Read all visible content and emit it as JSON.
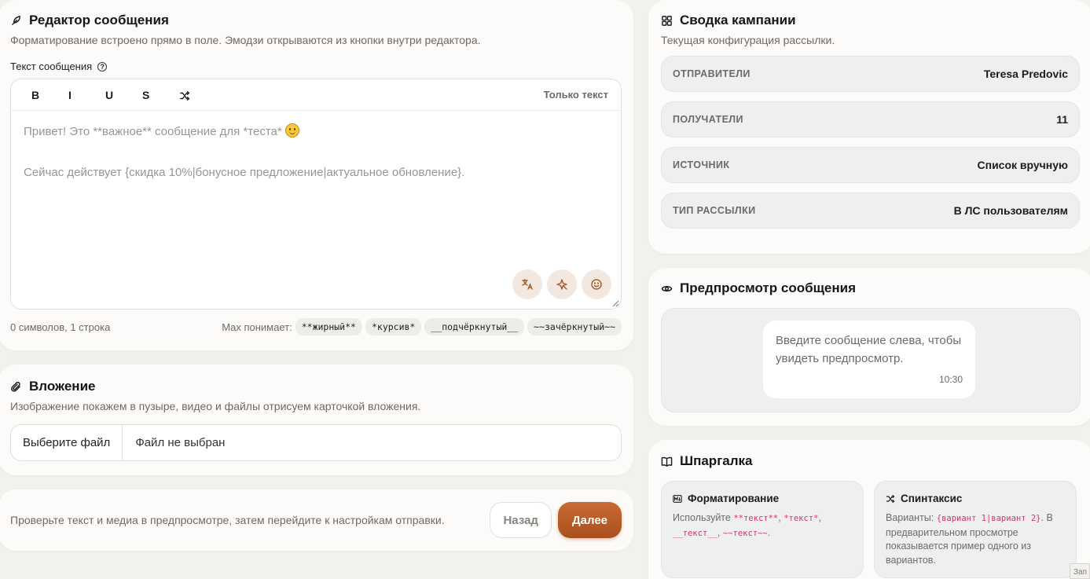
{
  "editor": {
    "title": "Редактор сообщения",
    "subtitle": "Форматирование встроено прямо в поле. Эмодзи открываются из кнопки внутри редактора.",
    "field_label": "Текст сообщения",
    "toolbar": {
      "bold": "B",
      "italic": "I",
      "underline": "U",
      "strike": "S",
      "plain_toggle": "Только текст"
    },
    "placeholder_line1": "Привет! Это **важное** сообщение для *теста*",
    "placeholder_line2": "Сейчас действует {скидка 10%|бонусное предложение|актуальное обновление}.",
    "counter": "0 символов, 1 строка",
    "max_label": "Max понимает:",
    "chips": [
      "**жирный**",
      "*курсив*",
      "__подчёркнутый__",
      "~~зачёркнутый~~"
    ]
  },
  "attachment": {
    "title": "Вложение",
    "subtitle": "Изображение покажем в пузыре, видео и файлы отрисуем карточкой вложения.",
    "choose_button": "Выберите файл",
    "file_status": "Файл не выбран"
  },
  "navigation": {
    "hint": "Проверьте текст и медиа в предпросмотре, затем перейдите к настройкам отправки.",
    "back": "Назад",
    "next": "Далее"
  },
  "summary": {
    "title": "Сводка кампании",
    "subtitle": "Текущая конфигурация рассылки.",
    "rows": [
      {
        "key": "ОТПРАВИТЕЛИ",
        "value": "Teresa Predovic"
      },
      {
        "key": "ПОЛУЧАТЕЛИ",
        "value": "11"
      },
      {
        "key": "ИСТОЧНИК",
        "value": "Список вручную"
      },
      {
        "key": "ТИП РАССЫЛКИ",
        "value": "В ЛС пользователям"
      }
    ]
  },
  "preview": {
    "title": "Предпросмотр сообщения",
    "bubble_text": "Введите сообщение слева, чтобы увидеть предпросмотр.",
    "time": "10:30"
  },
  "cheatsheet": {
    "title": "Шпаргалка",
    "formatting": {
      "title": "Форматирование",
      "prefix": "Используйте",
      "code1": "**текст**",
      "code2": "*текст*",
      "code3": "__текст__",
      "code4": "~~текст~~"
    },
    "spintax": {
      "title": "Спинтаксис",
      "prefix": "Варианты:",
      "code": "{вариант 1|вариант 2}",
      "suffix": ". В предварительном просмотре показывается пример одного из вариантов."
    }
  },
  "corner_badge": "Зап",
  "colors": {
    "accent": "#b85a26",
    "background": "#f3f1ee",
    "code": "#d6336c"
  }
}
